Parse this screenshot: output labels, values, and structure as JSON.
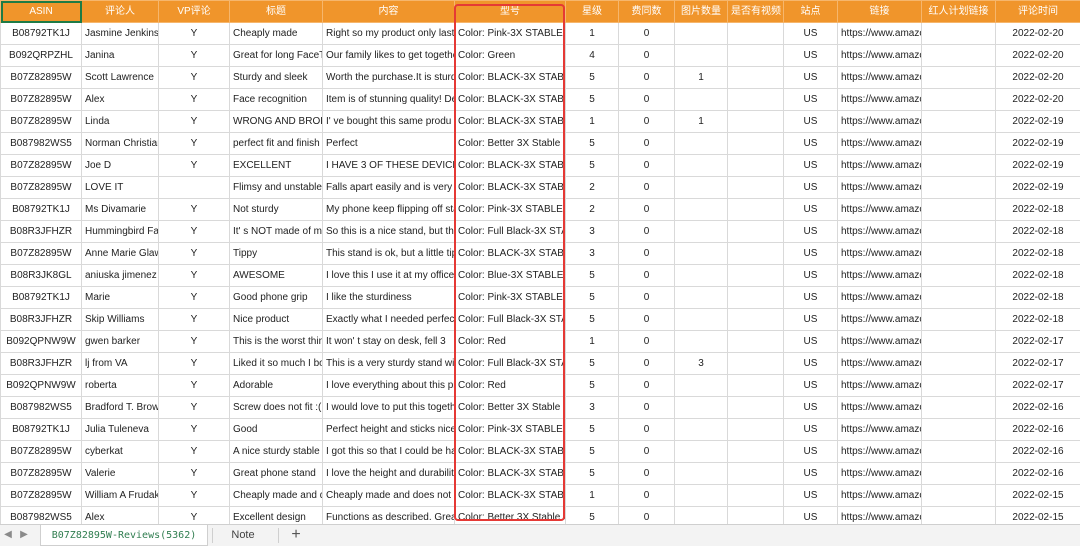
{
  "columns": [
    "ASIN",
    "评论人",
    "VP评论",
    "标题",
    "内容",
    "型号",
    "星级",
    "费同数",
    "图片数量",
    "是否有视频",
    "站点",
    "链接",
    "红人计划链接",
    "评论时间"
  ],
  "rows": [
    [
      "B08792TK1J",
      "Jasmine Jenkins",
      "Y",
      "Cheaply made",
      "Right so my product only lasted",
      "Color: Pink-3X STABLE W",
      "1",
      "0",
      "",
      "",
      "US",
      "https://www.amazo",
      "",
      "2022-02-20"
    ],
    [
      "B092QRPZHL",
      "Janina",
      "Y",
      "Great for long FaceTi",
      "Our family likes to get together",
      "Color: Green",
      "4",
      "0",
      "",
      "",
      "US",
      "https://www.amazo",
      "",
      "2022-02-20"
    ],
    [
      "B07Z82895W",
      "Scott Lawrence",
      "Y",
      "Sturdy and sleek",
      "Worth the purchase.It is sturdy",
      "Color: BLACK-3X STABLE",
      "5",
      "0",
      "1",
      "",
      "US",
      "https://www.amazo",
      "",
      "2022-02-20"
    ],
    [
      "B07Z82895W",
      "Alex",
      "Y",
      "Face recognition",
      "Item is of stunning quality! Def",
      "Color: BLACK-3X STABLE",
      "5",
      "0",
      "",
      "",
      "US",
      "https://www.amazo",
      "",
      "2022-02-20"
    ],
    [
      "B07Z82895W",
      "Linda",
      "Y",
      "WRONG AND BROKE",
      "I' ve bought this same produ",
      "Color: BLACK-3X STABLE",
      "1",
      "0",
      "1",
      "",
      "US",
      "https://www.amazo",
      "",
      "2022-02-19"
    ],
    [
      "B087982WS5",
      "Norman  Christian",
      "Y",
      "perfect fit and finish",
      "Perfect",
      "Color: Better 3X Stable W",
      "5",
      "0",
      "",
      "",
      "US",
      "https://www.amazo",
      "",
      "2022-02-19"
    ],
    [
      "B07Z82895W",
      "Joe D",
      "Y",
      "EXCELLENT",
      "I HAVE 3 OF THESE DEVICE",
      "Color: BLACK-3X STABLE",
      "5",
      "0",
      "",
      "",
      "US",
      "https://www.amazo",
      "",
      "2022-02-19"
    ],
    [
      "B07Z82895W",
      "LOVE IT",
      "",
      "Flimsy and unstable",
      "Falls apart easily and is very sh",
      "Color: BLACK-3X STABLE",
      "2",
      "0",
      "",
      "",
      "US",
      "https://www.amazo",
      "",
      "2022-02-19"
    ],
    [
      "B08792TK1J",
      "Ms Divamarie",
      "Y",
      "Not sturdy",
      "My phone keep flipping off sta",
      "Color: Pink-3X STABLE W",
      "2",
      "0",
      "",
      "",
      "US",
      "https://www.amazo",
      "",
      "2022-02-18"
    ],
    [
      "B08R3JFHZR",
      "Hummingbird Far",
      "Y",
      "It' s NOT made of m",
      "So this is a nice stand, but the",
      "Color: Full Black-3X STAB",
      "3",
      "0",
      "",
      "",
      "US",
      "https://www.amazo",
      "",
      "2022-02-18"
    ],
    [
      "B07Z82895W",
      "Anne Marie Glaw",
      "Y",
      "Tippy",
      "This stand is ok, but a little tipp",
      "Color: BLACK-3X STABLE",
      "3",
      "0",
      "",
      "",
      "US",
      "https://www.amazo",
      "",
      "2022-02-18"
    ],
    [
      "B08R3JK8GL",
      "aniuska jimenez",
      "Y",
      "AWESOME",
      "I love this I use it at my office a",
      "Color: Blue-3X STABLE W",
      "5",
      "0",
      "",
      "",
      "US",
      "https://www.amazo",
      "",
      "2022-02-18"
    ],
    [
      "B08792TK1J",
      "Marie",
      "Y",
      "Good phone grip",
      "I like the sturdiness",
      "Color: Pink-3X STABLE W",
      "5",
      "0",
      "",
      "",
      "US",
      "https://www.amazo",
      "",
      "2022-02-18"
    ],
    [
      "B08R3JFHZR",
      "Skip Williams",
      "Y",
      "Nice product",
      "Exactly what I needed perfect",
      "Color: Full Black-3X STAB",
      "5",
      "0",
      "",
      "",
      "US",
      "https://www.amazo",
      "",
      "2022-02-18"
    ],
    [
      "B092QPNW9W",
      "gwen barker",
      "Y",
      "This is the worst thing",
      "It won' t stay on desk, fell 3 ",
      "Color: Red",
      "1",
      "0",
      "",
      "",
      "US",
      "https://www.amazo",
      "",
      "2022-02-17"
    ],
    [
      "B08R3JFHZR",
      "lj from VA",
      "Y",
      "Liked it so much I bou",
      "This is a very sturdy stand with",
      "Color: Full Black-3X STAB",
      "5",
      "0",
      "3",
      "",
      "US",
      "https://www.amazo",
      "",
      "2022-02-17"
    ],
    [
      "B092QPNW9W",
      "roberta",
      "Y",
      "Adorable",
      "I love everything about this pro",
      "Color: Red",
      "5",
      "0",
      "",
      "",
      "US",
      "https://www.amazo",
      "",
      "2022-02-17"
    ],
    [
      "B087982WS5",
      "Bradford T. Brow",
      "Y",
      "Screw does not fit :(",
      "I would love to put this togethe",
      "Color: Better 3X Stable W",
      "3",
      "0",
      "",
      "",
      "US",
      "https://www.amazo",
      "",
      "2022-02-16"
    ],
    [
      "B08792TK1J",
      "Julia Tuleneva",
      "Y",
      "Good",
      "Perfect height and sticks nice ",
      "Color: Pink-3X STABLE W",
      "5",
      "0",
      "",
      "",
      "US",
      "https://www.amazo",
      "",
      "2022-02-16"
    ],
    [
      "B07Z82895W",
      "cyberkat",
      "Y",
      "A nice sturdy stable st",
      "I got this so that I could be han",
      "Color: BLACK-3X STABLE",
      "5",
      "0",
      "",
      "",
      "US",
      "https://www.amazo",
      "",
      "2022-02-16"
    ],
    [
      "B07Z82895W",
      "Valerie",
      "Y",
      "Great phone stand",
      "I love the height and durability",
      "Color: BLACK-3X STABLE",
      "5",
      "0",
      "",
      "",
      "US",
      "https://www.amazo",
      "",
      "2022-02-16"
    ],
    [
      "B07Z82895W",
      "William A Frudakis",
      "Y",
      "Cheaply made and do",
      "Cheaply made and does not e",
      "Color: BLACK-3X STABLE",
      "1",
      "0",
      "",
      "",
      "US",
      "https://www.amazo",
      "",
      "2022-02-15"
    ],
    [
      "B087982WS5",
      "Alex",
      "Y",
      "Excellent design",
      "Functions as described. Great",
      "Color: Better 3X Stable W",
      "5",
      "0",
      "",
      "",
      "US",
      "https://www.amazo",
      "",
      "2022-02-15"
    ]
  ],
  "sheet_tabs": {
    "active": "B07Z82895W-Reviews(5362)",
    "note": "Note",
    "add": "+"
  },
  "icons": {
    "prev": "◀",
    "next": "▶"
  },
  "colors": {
    "header": "#f0952b",
    "highlight": "#e53935",
    "active_tab_text": "#2f7d4f"
  }
}
